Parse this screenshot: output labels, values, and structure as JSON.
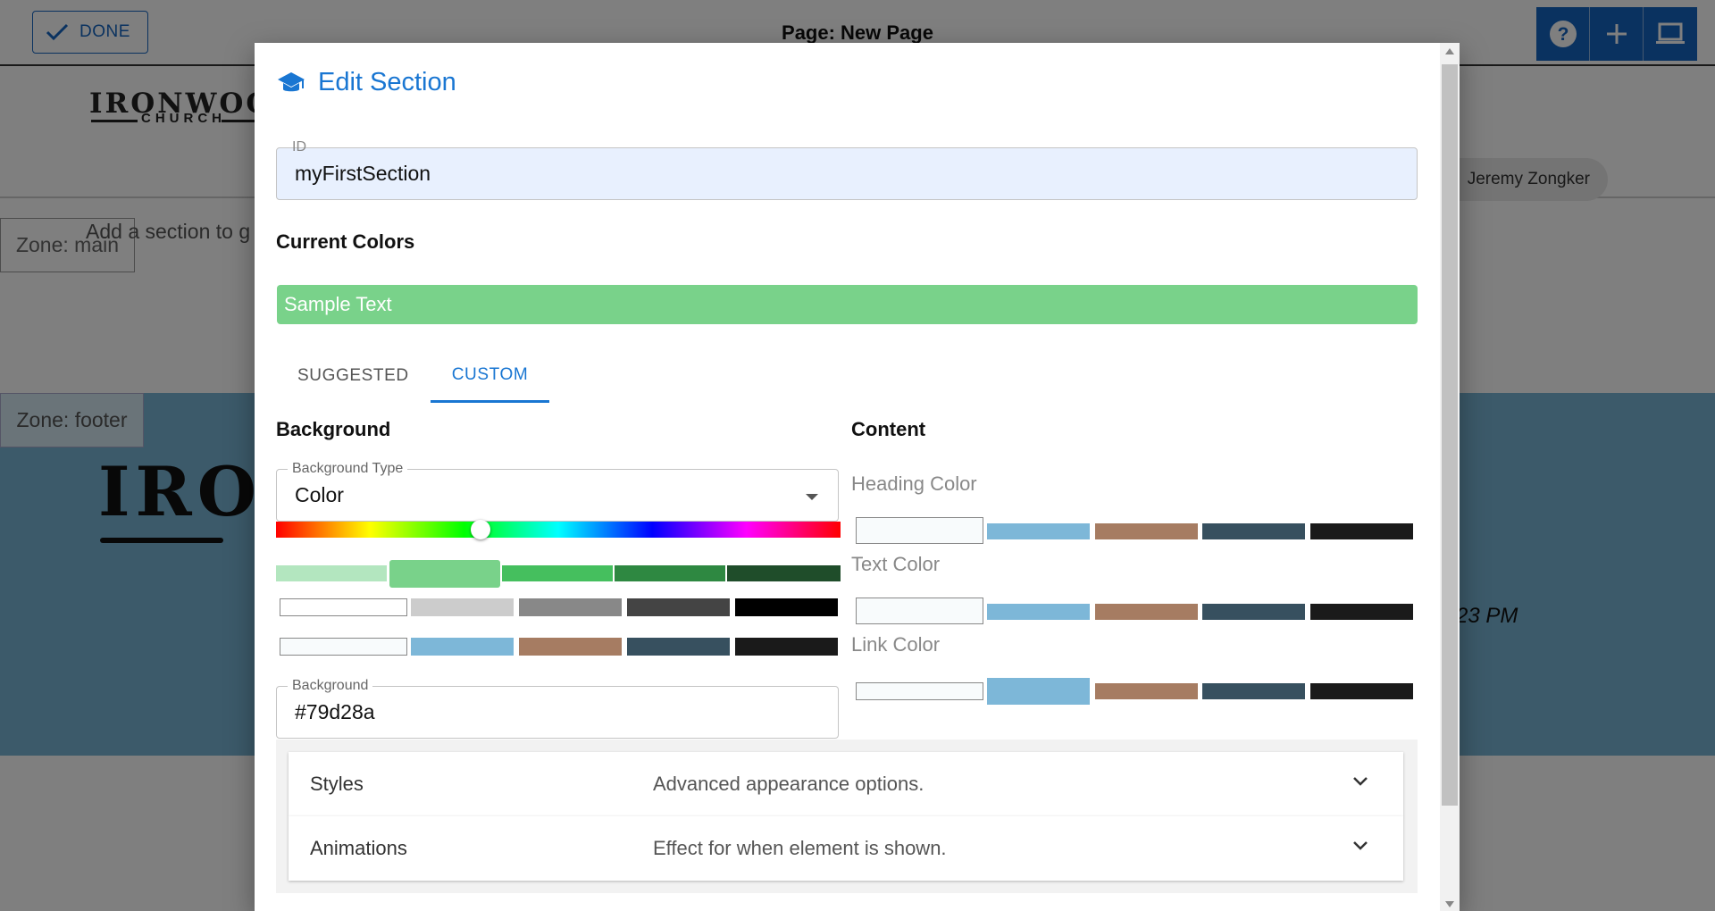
{
  "background_page": {
    "done_label": "DONE",
    "page_title": "Page: New Page",
    "logo_text": "IRONWOOD",
    "logo_sub": "CHURCH",
    "user_name": "Jeremy Zongker",
    "zone_main_label": "Zone: main",
    "add_section_text": "Add a section to g",
    "zone_footer_label": "Zone: footer",
    "footer_logo_text": "IRO",
    "footer_time_text": "23 PM",
    "top_actions": [
      "help-icon",
      "plus-icon",
      "laptop-icon"
    ]
  },
  "dialog": {
    "title": "Edit Section",
    "title_icon": "graduation-cap-icon",
    "id_field": {
      "label": "ID",
      "value": "myFirstSection"
    },
    "current_colors_heading": "Current Colors",
    "sample_text": "Sample Text",
    "sample_bg": "#79d28a",
    "tabs": [
      {
        "label": "SUGGESTED",
        "active": false
      },
      {
        "label": "CUSTOM",
        "active": true
      }
    ],
    "background": {
      "heading": "Background",
      "type_label": "Background Type",
      "type_value": "Color",
      "shades": [
        "#b3e6bf",
        "#79d28a",
        "#45bf5e",
        "#2e8841",
        "#1f4d2a"
      ],
      "selected_shade": "#79d28a",
      "grays": [
        "#ffffff",
        "#cccccc",
        "#888888",
        "#444444",
        "#000000"
      ],
      "palette": [
        "#f8fbfc",
        "#7db7d8",
        "#a67c62",
        "#37505f",
        "#1a1a1a"
      ],
      "field_label": "Background",
      "field_value": "#79d28a"
    },
    "content": {
      "heading": "Content",
      "heading_color_label": "Heading Color",
      "text_color_label": "Text Color",
      "link_color_label": "Link Color",
      "palette": [
        "#f8fbfc",
        "#7db7d8",
        "#a67c62",
        "#37505f",
        "#1a1a1a"
      ]
    },
    "accordions": [
      {
        "title": "Styles",
        "description": "Advanced appearance options."
      },
      {
        "title": "Animations",
        "description": "Effect for when element is shown."
      }
    ]
  },
  "colors": {
    "accent": "#1976d2",
    "topbar_blue": "#1565c0",
    "footer_bg": "#79b4d4"
  }
}
